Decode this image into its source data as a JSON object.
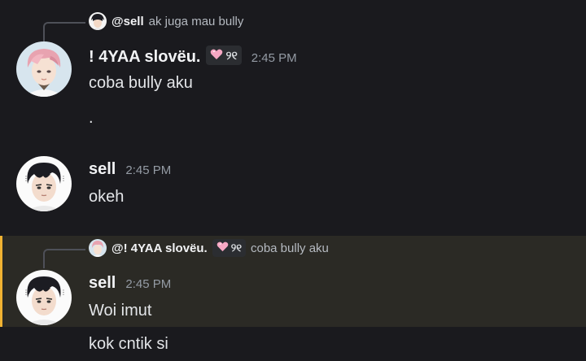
{
  "colors": {
    "background": "#1a1a1e",
    "mention_highlight_bg": "#2b2a25",
    "mention_highlight_bar": "#f0b232",
    "tag_heart": "#f7a8c4"
  },
  "messages": [
    {
      "reply": {
        "author": "@sell",
        "text": "ak juga mau bully"
      },
      "author": "! 4YAA slovëu.",
      "tag": "୨୧",
      "timestamp": "2:45 PM",
      "lines": [
        "coba bully aku",
        "."
      ]
    },
    {
      "author": "sell",
      "timestamp": "2:45 PM",
      "lines": [
        "okeh"
      ]
    },
    {
      "reply": {
        "author": "@! 4YAA slovëu.",
        "tag": "୨୧",
        "text": "coba bully aku"
      },
      "author": "sell",
      "timestamp": "2:45 PM",
      "lines": [
        "Woi imut",
        "kok cntik si"
      ]
    }
  ]
}
